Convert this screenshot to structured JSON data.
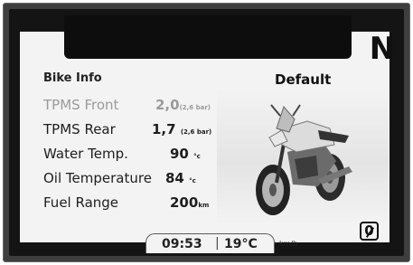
{
  "gear": "N",
  "section_title": "Bike Info",
  "mode_title": "Default",
  "rows": [
    {
      "label": "TPMS Front",
      "value": "2,0",
      "unit": "(2,6 bar)"
    },
    {
      "label": "TPMS Rear",
      "value": "1,7",
      "unit": "(2,6 bar)"
    },
    {
      "label": "Water Temp.",
      "value": "90",
      "unit": "°c"
    },
    {
      "label": "Oil Temperature",
      "value": "84",
      "unit": "°c"
    },
    {
      "label": "Fuel Range",
      "value": "200",
      "unit": "km"
    }
  ],
  "status": {
    "time": "09:53",
    "separator": "|",
    "temperature": "19°C",
    "speed_unit": "km/h"
  },
  "indicator": {
    "icon": "zero-slash-icon",
    "label": "0"
  },
  "colors": {
    "screen_bg": "#f3f3f3",
    "bezel": "#141414",
    "dim_text": "#9a9a9a"
  }
}
